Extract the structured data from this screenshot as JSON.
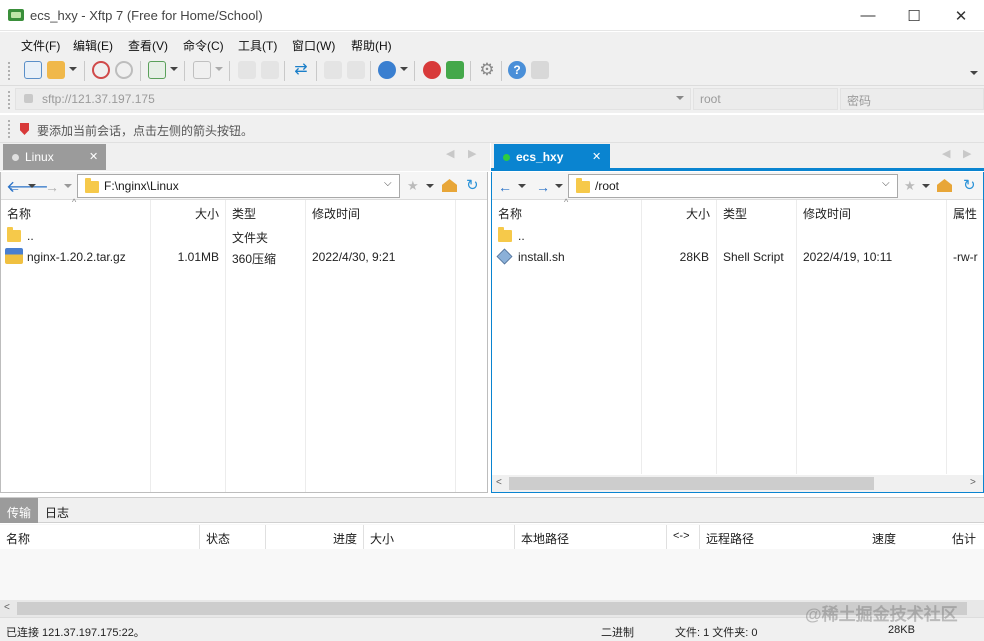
{
  "window": {
    "title": "ecs_hxy - Xftp 7 (Free for Home/School)",
    "minimize": "—",
    "maximize": "☐",
    "close": "✕"
  },
  "menu": [
    "文件(F)",
    "编辑(E)",
    "查看(V)",
    "命令(C)",
    "工具(T)",
    "窗口(W)",
    "帮助(H)"
  ],
  "address": {
    "host": "sftp://121.37.197.175",
    "user": "root",
    "password_placeholder": "密码"
  },
  "hint": "要添加当前会话，点击左侧的箭头按钮。",
  "colors": {
    "accent": "#0a84d0",
    "active_dot": "#2ecc40",
    "folder": "#f6c94a"
  },
  "left_pane": {
    "tab_label": "Linux",
    "path": "F:\\nginx\\Linux",
    "columns": [
      "名称",
      "大小",
      "类型",
      "修改时间"
    ],
    "rows": [
      {
        "name": "..",
        "size": "",
        "type": "文件夹",
        "modified": ""
      },
      {
        "name": "nginx-1.20.2.tar.gz",
        "size": "1.01MB",
        "type": "360压缩",
        "modified": "2022/4/30, 9:21"
      }
    ]
  },
  "right_pane": {
    "tab_label": "ecs_hxy",
    "path": "/root",
    "columns": [
      "名称",
      "大小",
      "类型",
      "修改时间",
      "属性"
    ],
    "rows": [
      {
        "name": "..",
        "size": "",
        "type": "",
        "modified": "",
        "attr": ""
      },
      {
        "name": "install.sh",
        "size": "28KB",
        "type": "Shell Script",
        "modified": "2022/4/19, 10:11",
        "attr": "-rw-r"
      }
    ]
  },
  "bottom": {
    "tabs": [
      "传输",
      "日志"
    ],
    "columns": [
      "名称",
      "状态",
      "进度",
      "大小",
      "本地路径",
      "<->",
      "远程路径",
      "速度",
      "估计索"
    ]
  },
  "status": {
    "connection": "已连接 121.37.197.175:22。",
    "mode": "二进制",
    "counts": "文件: 1  文件夹: 0",
    "size": "28KB",
    "watermark": "@稀土掘金技术社区"
  }
}
